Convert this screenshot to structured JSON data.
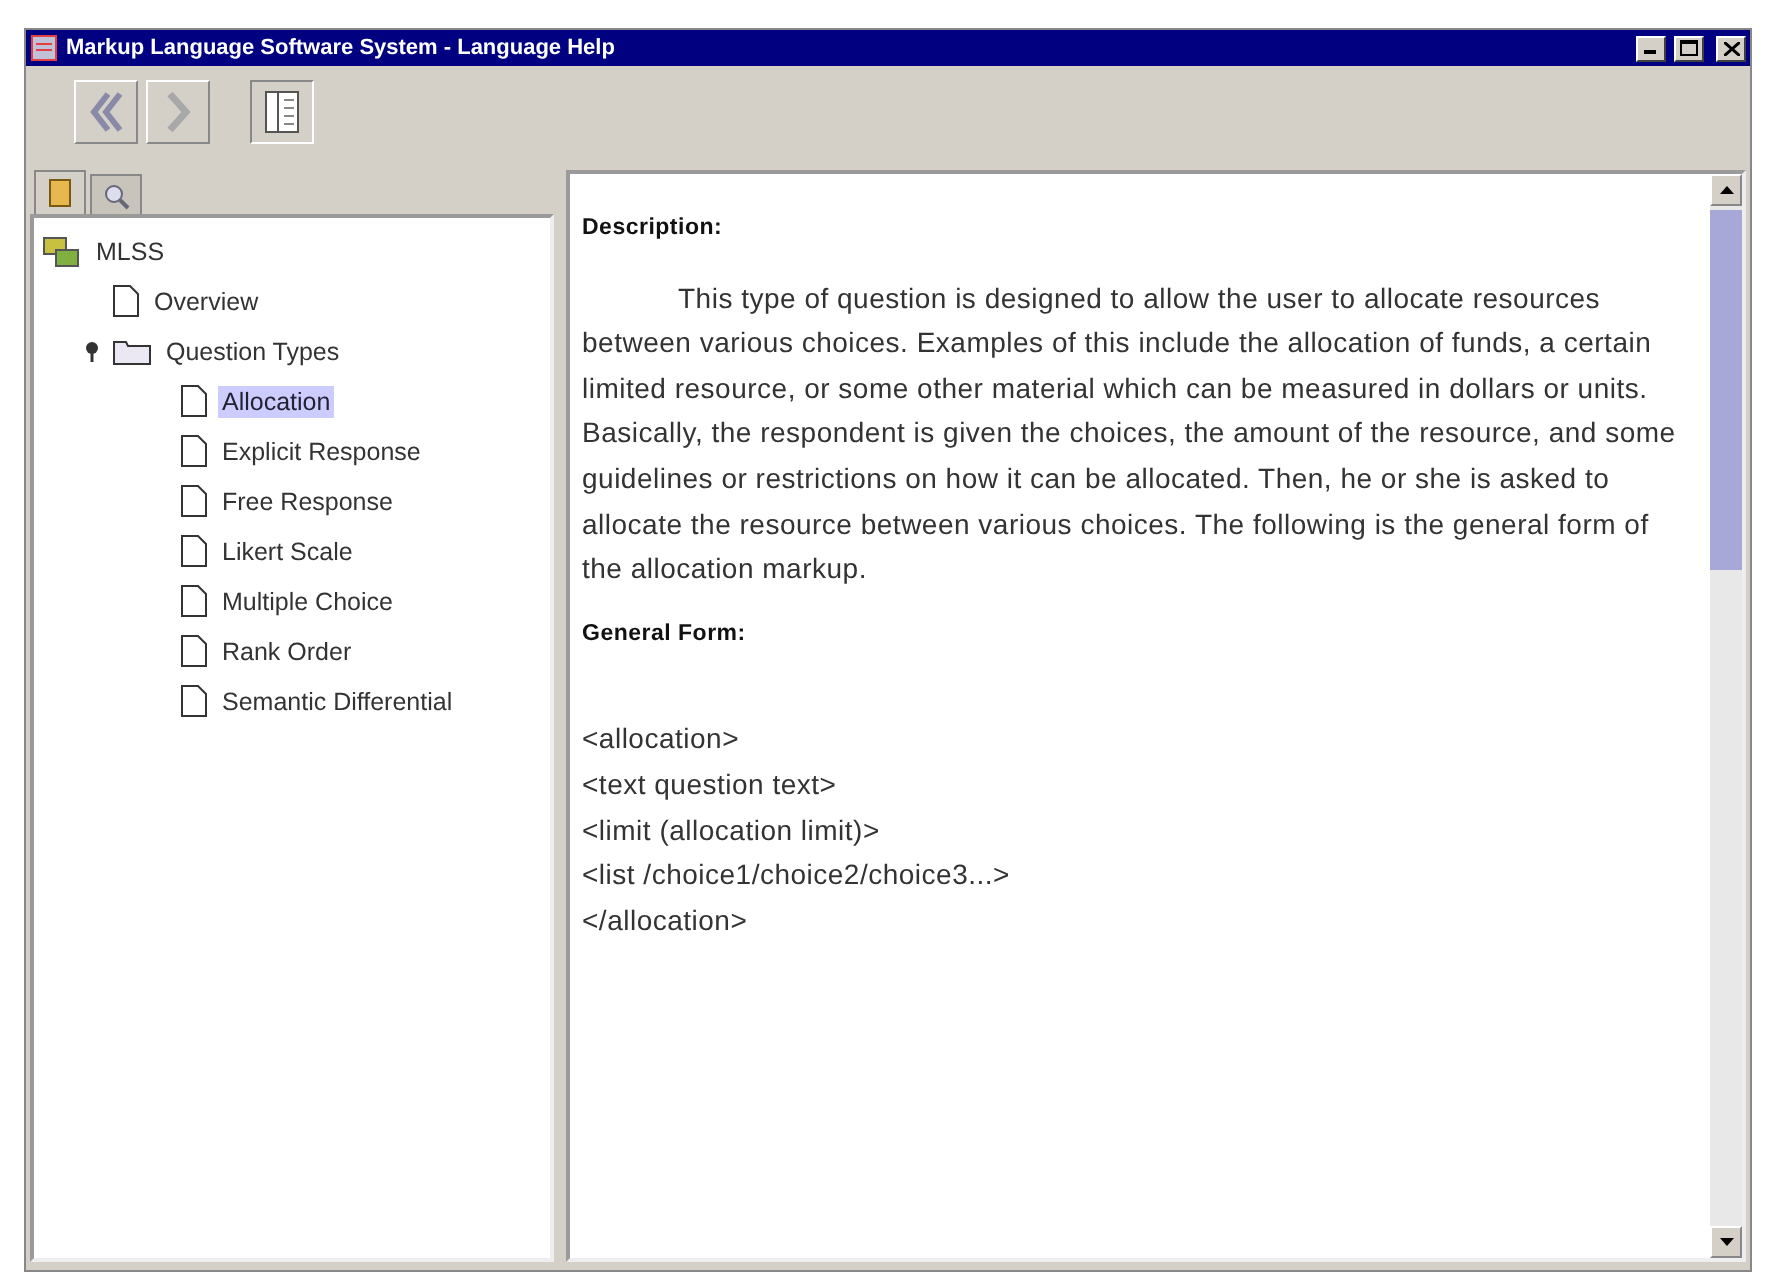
{
  "window": {
    "title": "Markup Language Software System - Language Help"
  },
  "nav_tabs": [
    {
      "kind": "contents",
      "selected": true
    },
    {
      "kind": "search",
      "selected": false
    }
  ],
  "tree": [
    {
      "label": "MLSS",
      "kind": "root",
      "selected": false,
      "children": [
        {
          "label": "Overview",
          "kind": "page",
          "selected": false
        },
        {
          "label": "Question Types",
          "kind": "folder",
          "selected": false,
          "expanded": true,
          "children": [
            {
              "label": "Allocation",
              "kind": "page",
              "selected": true
            },
            {
              "label": "Explicit Response",
              "kind": "page",
              "selected": false
            },
            {
              "label": "Free Response",
              "kind": "page",
              "selected": false
            },
            {
              "label": "Likert Scale",
              "kind": "page",
              "selected": false
            },
            {
              "label": "Multiple Choice",
              "kind": "page",
              "selected": false
            },
            {
              "label": "Rank Order",
              "kind": "page",
              "selected": false
            },
            {
              "label": "Semantic Differential",
              "kind": "page",
              "selected": false
            }
          ]
        }
      ]
    }
  ],
  "content": {
    "description_heading": "Description:",
    "description": "This type of question is designed to allow the user to allocate resources between various choices. Examples of this include the allocation of funds, a certain limited resource, or some other material which can be measured in dollars or units. Basically, the respondent is given the choices, the amount of the resource, and some guidelines or restrictions on how it can be allocated. Then, he or she is asked to allocate the resource between various choices. The following is the general form of the allocation markup.",
    "form_heading": "General Form:",
    "form_lines": [
      "<allocation>",
      "<text question text>",
      "<limit (allocation limit)>",
      "<list /choice1/choice2/choice3...>",
      "</allocation>"
    ]
  }
}
